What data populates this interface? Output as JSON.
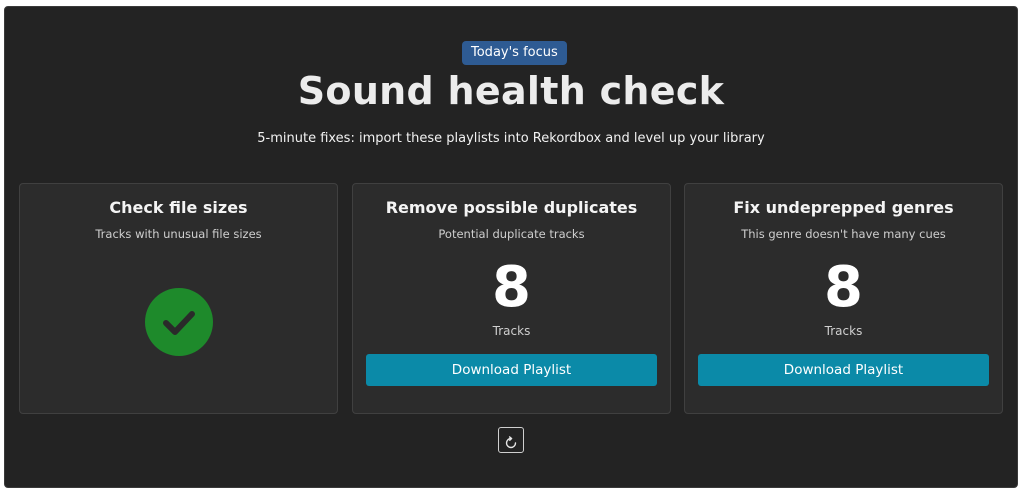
{
  "header": {
    "badge": "Today's focus",
    "title": "Sound health check",
    "subtitle": "5-minute fixes: import these playlists into Rekordbox and level up your library"
  },
  "cards": [
    {
      "title": "Check file sizes",
      "description": "Tracks with unusual file sizes",
      "status_icon": "check-circle-icon",
      "status_color": "#1e8a2b"
    },
    {
      "title": "Remove possible duplicates",
      "description": "Potential duplicate tracks",
      "count": "8",
      "count_label": "Tracks",
      "button_label": "Download Playlist"
    },
    {
      "title": "Fix undeprepped genres",
      "description": "This genre doesn't have many cues",
      "count": "8",
      "count_label": "Tracks",
      "button_label": "Download Playlist"
    }
  ],
  "footer": {
    "refresh_icon": "refresh-icon"
  },
  "colors": {
    "background": "#232323",
    "card": "#2c2c2c",
    "badge": "#2e5b93",
    "button": "#0b8aa8",
    "success": "#1e8a2b"
  }
}
